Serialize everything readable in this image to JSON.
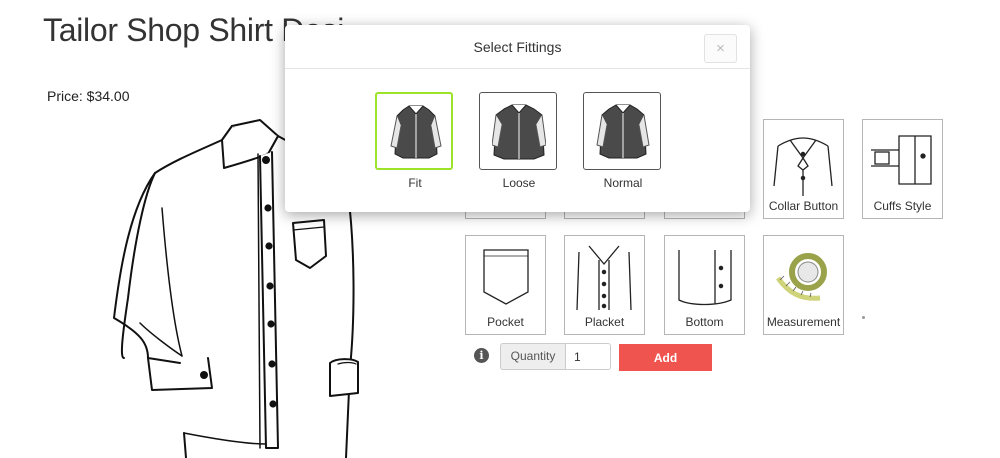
{
  "page": {
    "title": "Tailor Shop Shirt Desi",
    "price": "Price: $34.00"
  },
  "options": [
    {
      "label": "Collar Button",
      "icon": "collar-button-icon"
    },
    {
      "label": "Cuffs Style",
      "icon": "cuffs-style-icon"
    },
    {
      "label": "Pocket",
      "icon": "pocket-icon"
    },
    {
      "label": "Placket",
      "icon": "placket-icon"
    },
    {
      "label": "Bottom",
      "icon": "bottom-icon"
    },
    {
      "label": "Measurement",
      "icon": "measuring-tape-icon"
    }
  ],
  "cart": {
    "quantity_label": "Quantity",
    "quantity_value": "1",
    "add_label": "Add"
  },
  "modal": {
    "title": "Select Fittings",
    "close_glyph": "×",
    "fittings": [
      {
        "label": "Fit",
        "selected": true
      },
      {
        "label": "Loose",
        "selected": false
      },
      {
        "label": "Normal",
        "selected": false
      }
    ],
    "selected_border_color": "#9ce32a"
  },
  "colors": {
    "add_button": "#f0544f",
    "text": "#333333"
  }
}
